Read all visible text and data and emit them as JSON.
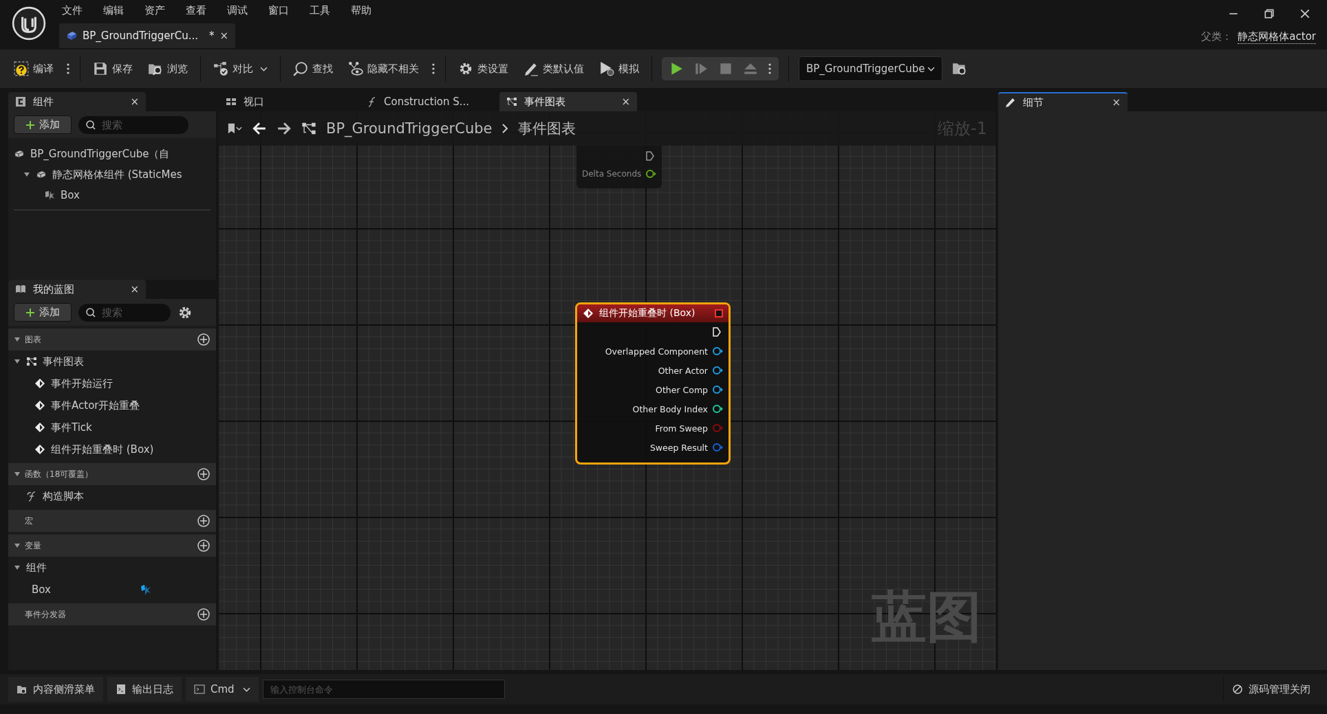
{
  "menu": [
    "文件",
    "编辑",
    "资产",
    "查看",
    "调试",
    "窗口",
    "工具",
    "帮助"
  ],
  "document_tab": {
    "title": "BP_GroundTriggerCu...",
    "modified_mark": "*",
    "close": "×"
  },
  "parent_class": {
    "label": "父类：",
    "value": "静态网格体actor"
  },
  "toolbar": {
    "compile": "编译",
    "save": "保存",
    "browse": "浏览",
    "diff": "对比",
    "find": "查找",
    "hide_unrelated": "隐藏不相关",
    "class_settings": "类设置",
    "class_defaults": "类默认值",
    "simulate": "模拟",
    "debug_object": "BP_GroundTriggerCube"
  },
  "components_panel": {
    "title": "组件",
    "close": "×",
    "add": "添加",
    "search_placeholder": "搜索",
    "tree": [
      {
        "label": "BP_GroundTriggerCube（自",
        "children": [
          {
            "label": "静态网格体组件 (StaticMes",
            "expanded": true,
            "children": [
              {
                "label": "Box"
              }
            ]
          }
        ]
      }
    ]
  },
  "my_blueprint_panel": {
    "title": "我的蓝图",
    "close": "×",
    "add": "添加",
    "search_placeholder": "搜索",
    "sections": [
      {
        "kind": "category",
        "label": "图表",
        "expanded": true,
        "children": [
          {
            "kind": "graph",
            "label": "事件图表",
            "expanded": true,
            "children": [
              {
                "kind": "event",
                "label": "事件开始运行"
              },
              {
                "kind": "event",
                "label": "事件Actor开始重叠"
              },
              {
                "kind": "event",
                "label": "事件Tick"
              },
              {
                "kind": "event",
                "label": "组件开始重叠时 (Box)"
              }
            ]
          }
        ]
      },
      {
        "kind": "category",
        "label": "函数（18可覆盖）",
        "expanded": true,
        "children": [
          {
            "kind": "function",
            "label": "构造脚本"
          }
        ]
      },
      {
        "kind": "category",
        "label": "宏"
      },
      {
        "kind": "category",
        "label": "变量",
        "expanded": true,
        "children": [
          {
            "kind": "group",
            "label": "组件",
            "expanded": true,
            "children": [
              {
                "kind": "variable",
                "label": "Box"
              }
            ]
          }
        ]
      },
      {
        "kind": "category",
        "label": "事件分发器"
      }
    ]
  },
  "graph_tabs": [
    {
      "label": "视口",
      "selected": false
    },
    {
      "label": "Construction S...",
      "selected": false
    },
    {
      "label": "事件图表",
      "selected": true,
      "close": "×"
    }
  ],
  "breadcrumb": {
    "blueprint": "BP_GroundTriggerCube",
    "graph": "事件图表",
    "zoom": "缩放-1"
  },
  "ghost_node": {
    "pins": [
      {
        "kind": "exec"
      },
      {
        "kind": "data",
        "label": "Delta Seconds",
        "color": "#5fa61c"
      }
    ]
  },
  "event_node": {
    "title": "组件开始重叠时 (Box)",
    "selected": true,
    "pins": [
      {
        "kind": "exec"
      },
      {
        "kind": "data",
        "label": "Overlapped Component",
        "color": "#1d9be0"
      },
      {
        "kind": "data",
        "label": "Other Actor",
        "color": "#1d9be0"
      },
      {
        "kind": "data",
        "label": "Other Comp",
        "color": "#1d9be0"
      },
      {
        "kind": "data",
        "label": "Other Body Index",
        "color": "#1ec99a"
      },
      {
        "kind": "data",
        "label": "From Sweep",
        "color": "#8c0a0a"
      },
      {
        "kind": "data",
        "label": "Sweep Result",
        "color": "#1464d8"
      }
    ]
  },
  "graph_watermark": "蓝图",
  "details_panel": {
    "title": "细节",
    "close": "×"
  },
  "bottom_bar": {
    "content_drawer": "内容侧滑菜单",
    "output_log": "输出日志",
    "cmd": "Cmd",
    "console_placeholder": "输入控制台命令",
    "source_control": "源码管理关闭"
  }
}
